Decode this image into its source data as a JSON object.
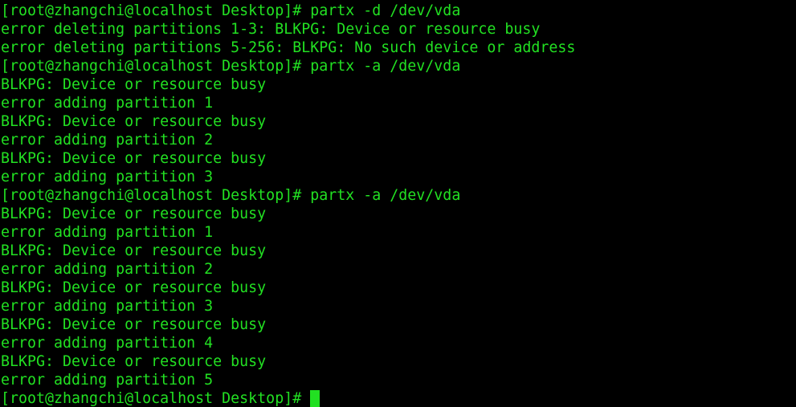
{
  "terminal": {
    "colors": {
      "background": "#000000",
      "foreground": "#22e022",
      "cursor": "#22e022"
    },
    "lines": [
      "[root@zhangchi@localhost Desktop]# partx -d /dev/vda",
      "error deleting partitions 1-3: BLKPG: Device or resource busy",
      "error deleting partitions 5-256: BLKPG: No such device or address",
      "[root@zhangchi@localhost Desktop]# partx -a /dev/vda",
      "BLKPG: Device or resource busy",
      "error adding partition 1",
      "BLKPG: Device or resource busy",
      "error adding partition 2",
      "BLKPG: Device or resource busy",
      "error adding partition 3",
      "[root@zhangchi@localhost Desktop]# partx -a /dev/vda",
      "BLKPG: Device or resource busy",
      "error adding partition 1",
      "BLKPG: Device or resource busy",
      "error adding partition 2",
      "BLKPG: Device or resource busy",
      "error adding partition 3",
      "BLKPG: Device or resource busy",
      "error adding partition 4",
      "BLKPG: Device or resource busy",
      "error adding partition 5"
    ],
    "prompt": "[root@zhangchi@localhost Desktop]# "
  }
}
